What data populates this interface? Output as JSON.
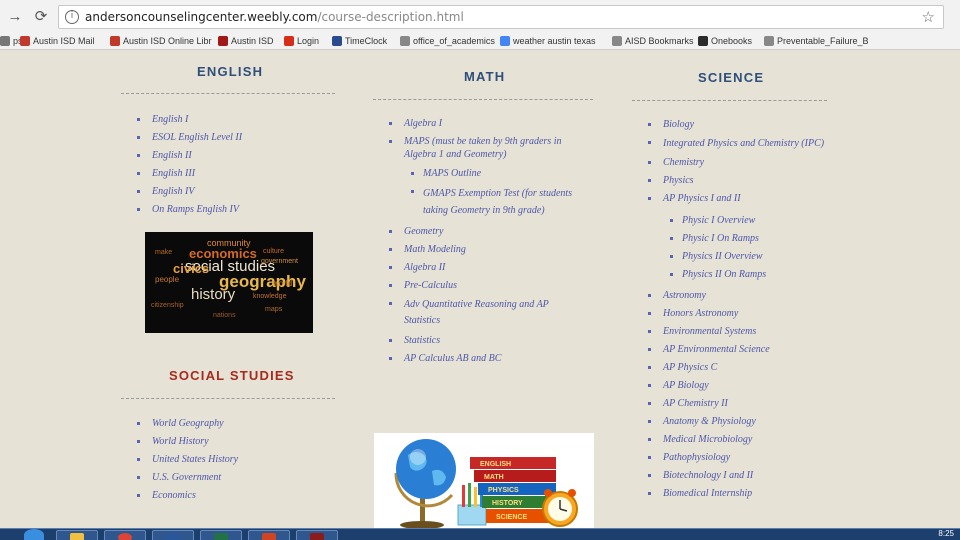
{
  "browser": {
    "url_host": "andersoncounselingcenter.weebly.com",
    "url_path": "/course-description.html",
    "bookmarks": [
      {
        "label": "ps",
        "icon": "partial-icon",
        "color": "#777777"
      },
      {
        "label": "Austin ISD Mail",
        "icon": "aisd-icon",
        "color": "#c0392b"
      },
      {
        "label": "Austin ISD Online Libr",
        "icon": "aisd-icon",
        "color": "#c0392b"
      },
      {
        "label": "Austin ISD",
        "icon": "apple-icon",
        "color": "#a01818"
      },
      {
        "label": "Login",
        "icon": "power-icon",
        "color": "#d62c1a"
      },
      {
        "label": "TimeClock",
        "icon": "w-icon",
        "color": "#2b4c8c"
      },
      {
        "label": "office_of_academics",
        "icon": "page-icon",
        "color": "#888888"
      },
      {
        "label": "weather austin texas",
        "icon": "google-icon",
        "color": "#4285f4"
      },
      {
        "label": "AISD Bookmarks",
        "icon": "page-icon",
        "color": "#888888"
      },
      {
        "label": "Onebooks",
        "icon": "book-icon",
        "color": "#2b2b2b"
      },
      {
        "label": "Preventable_Failure_B",
        "icon": "page-icon",
        "color": "#888888"
      }
    ]
  },
  "english": {
    "title": "ENGLISH",
    "items": [
      "English I",
      "ESOL English Level II",
      "English II",
      "English III",
      "English IV",
      "On Ramps English IV"
    ]
  },
  "math": {
    "title": "MATH",
    "items_top": [
      "Algebra I",
      "MAPS (must be taken by 9th graders in Algebra 1 and Geometry)"
    ],
    "sub_items": [
      "MAPS Outline",
      "GMAPS Exemption Test (for students taking Geometry in 9th grade)"
    ],
    "items_bottom": [
      "Geometry",
      "Math Modeling",
      "Algebra II",
      "Pre-Calculus",
      "Adv Quantitative Reasoning and AP Statistics",
      "Statistics",
      "AP Calculus AB and BC"
    ]
  },
  "science": {
    "title": "SCIENCE",
    "items_top": [
      "Biology",
      "Integrated Physics and Chemistry (IPC)",
      "Chemistry",
      "Physics",
      "AP Physics I and II"
    ],
    "sub_items": [
      "Physic I Overview",
      "Physic I On Ramps",
      "Physics II Overview",
      "Physics II On Ramps"
    ],
    "items_bottom": [
      "Astronomy",
      "Honors Astronomy",
      "Environmental Systems",
      "AP Environmental Science",
      "AP Physics C",
      "AP Biology",
      "AP Chemistry II",
      "Anatomy & Physiology",
      "Medical Microbiology",
      "Pathophysiology",
      "Biotechnology I and II",
      "Biomedical Internship"
    ]
  },
  "social_studies": {
    "title": "SOCIAL STUDIES",
    "items": [
      "World Geography",
      "World History",
      "United States History",
      "U.S. Government",
      "Economics"
    ]
  },
  "wordcloud": {
    "words": [
      "community",
      "economics",
      "social studies",
      "civics",
      "geography",
      "history",
      "knowledge",
      "make",
      "culture",
      "government",
      "citizenship",
      "people",
      "world",
      "maps",
      "nations"
    ]
  },
  "books_image": {
    "spines": [
      "ENGLISH",
      "MATH",
      "PHYSICS",
      "HISTORY",
      "SCIENCE"
    ]
  },
  "taskbar": {
    "clock": "8:25"
  }
}
